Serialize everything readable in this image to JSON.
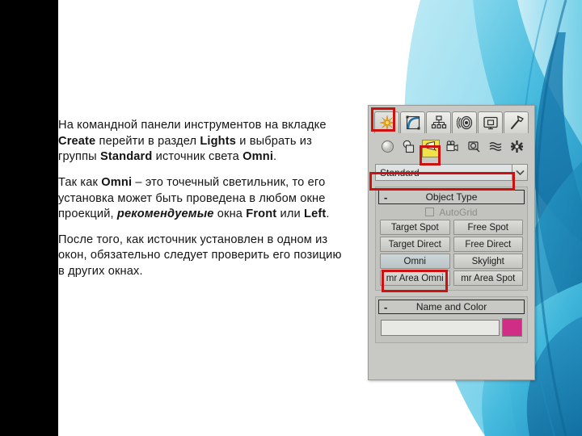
{
  "slide": {
    "background_white": "#ffffff",
    "left_bar_color": "#000000",
    "ribbon_colors": [
      "#5ecbe4",
      "#3ab4d8",
      "#1a84b8",
      "#0d6a9c",
      "#a7e3f0",
      "#d8f2f8"
    ]
  },
  "content": {
    "paragraphs": [
      {
        "id": "p1",
        "runs": [
          {
            "text": "На командной панели инструментов на вкладке ",
            "bold": false,
            "italic": false
          },
          {
            "text": "Create",
            "bold": true,
            "italic": false
          },
          {
            "text": " перейти в раздел ",
            "bold": false,
            "italic": false
          },
          {
            "text": "Lights",
            "bold": true,
            "italic": false
          },
          {
            "text": " и выбрать из группы ",
            "bold": false,
            "italic": false
          },
          {
            "text": "Standard",
            "bold": true,
            "italic": false
          },
          {
            "text": " источник света ",
            "bold": false,
            "italic": false
          },
          {
            "text": "Omni",
            "bold": true,
            "italic": false
          },
          {
            "text": ".",
            "bold": false,
            "italic": false
          }
        ]
      },
      {
        "id": "p2",
        "runs": [
          {
            "text": "Так как ",
            "bold": false,
            "italic": false
          },
          {
            "text": "Omni",
            "bold": true,
            "italic": false
          },
          {
            "text": " – это точечный светильник, то его установка может быть проведена в любом окне проекций, ",
            "bold": false,
            "italic": false
          },
          {
            "text": "рекомендуемые",
            "bold": true,
            "italic": true
          },
          {
            "text": " окна ",
            "bold": false,
            "italic": false
          },
          {
            "text": "Front",
            "bold": true,
            "italic": false
          },
          {
            "text": " или ",
            "bold": false,
            "italic": false
          },
          {
            "text": "Left",
            "bold": true,
            "italic": false
          },
          {
            "text": ".",
            "bold": false,
            "italic": false
          }
        ]
      },
      {
        "id": "p3",
        "runs": [
          {
            "text": "После того, как источник установлен в одном из окон, обязательно следует проверить его позицию в других окнах.",
            "bold": false,
            "italic": false
          }
        ]
      }
    ]
  },
  "command_panel": {
    "tabs": [
      {
        "name": "create",
        "icon": "star-icon",
        "label": "Create",
        "active": true
      },
      {
        "name": "modify",
        "icon": "modify-arc-icon",
        "label": "Modify",
        "active": false
      },
      {
        "name": "hierarchy",
        "icon": "hierarchy-icon",
        "label": "Hierarchy",
        "active": false
      },
      {
        "name": "motion",
        "icon": "motion-rings-icon",
        "label": "Motion",
        "active": false
      },
      {
        "name": "display",
        "icon": "display-monitor-icon",
        "label": "Display",
        "active": false
      },
      {
        "name": "utilities",
        "icon": "hammer-icon",
        "label": "Utilities",
        "active": false
      }
    ],
    "categories": [
      {
        "name": "geometry",
        "icon": "sphere-icon",
        "label": "Geometry",
        "active": false
      },
      {
        "name": "shapes",
        "icon": "shapes-icon",
        "label": "Shapes",
        "active": false
      },
      {
        "name": "lights",
        "icon": "light-bulb-icon",
        "label": "Lights",
        "active": true
      },
      {
        "name": "cameras",
        "icon": "camera-icon",
        "label": "Cameras",
        "active": false
      },
      {
        "name": "helpers",
        "icon": "tape-measure-icon",
        "label": "Helpers",
        "active": false
      },
      {
        "name": "spacewarps",
        "icon": "waves-icon",
        "label": "Space Warps",
        "active": false
      },
      {
        "name": "systems",
        "icon": "systems-gear-icon",
        "label": "Systems",
        "active": false
      }
    ],
    "dropdown": {
      "value": "Standard",
      "arrow_icon": "chevron-down-icon"
    },
    "object_type_rollout": {
      "collapse_glyph": "-",
      "title": "Object Type",
      "autogrid": {
        "label": "AutoGrid",
        "checked": false,
        "enabled": false
      },
      "buttons": [
        {
          "label": "Target Spot",
          "selected": false
        },
        {
          "label": "Free Spot",
          "selected": false
        },
        {
          "label": "Target Direct",
          "selected": false
        },
        {
          "label": "Free Direct",
          "selected": false
        },
        {
          "label": "Omni",
          "selected": true
        },
        {
          "label": "Skylight",
          "selected": false
        },
        {
          "label": "mr Area Omni",
          "selected": false
        },
        {
          "label": "mr Area Spot",
          "selected": false
        }
      ]
    },
    "name_and_color_rollout": {
      "collapse_glyph": "-",
      "title": "Name and Color",
      "name_value": "",
      "color_swatch": "#cf2d86"
    }
  },
  "highlights": [
    {
      "name": "create-tab-highlight",
      "color": "#cc1111"
    },
    {
      "name": "lights-category-highlight",
      "color": "#cc1111"
    },
    {
      "name": "standard-dropdown-highlight",
      "color": "#cc1111"
    },
    {
      "name": "omni-button-highlight",
      "color": "#cc1111"
    }
  ]
}
